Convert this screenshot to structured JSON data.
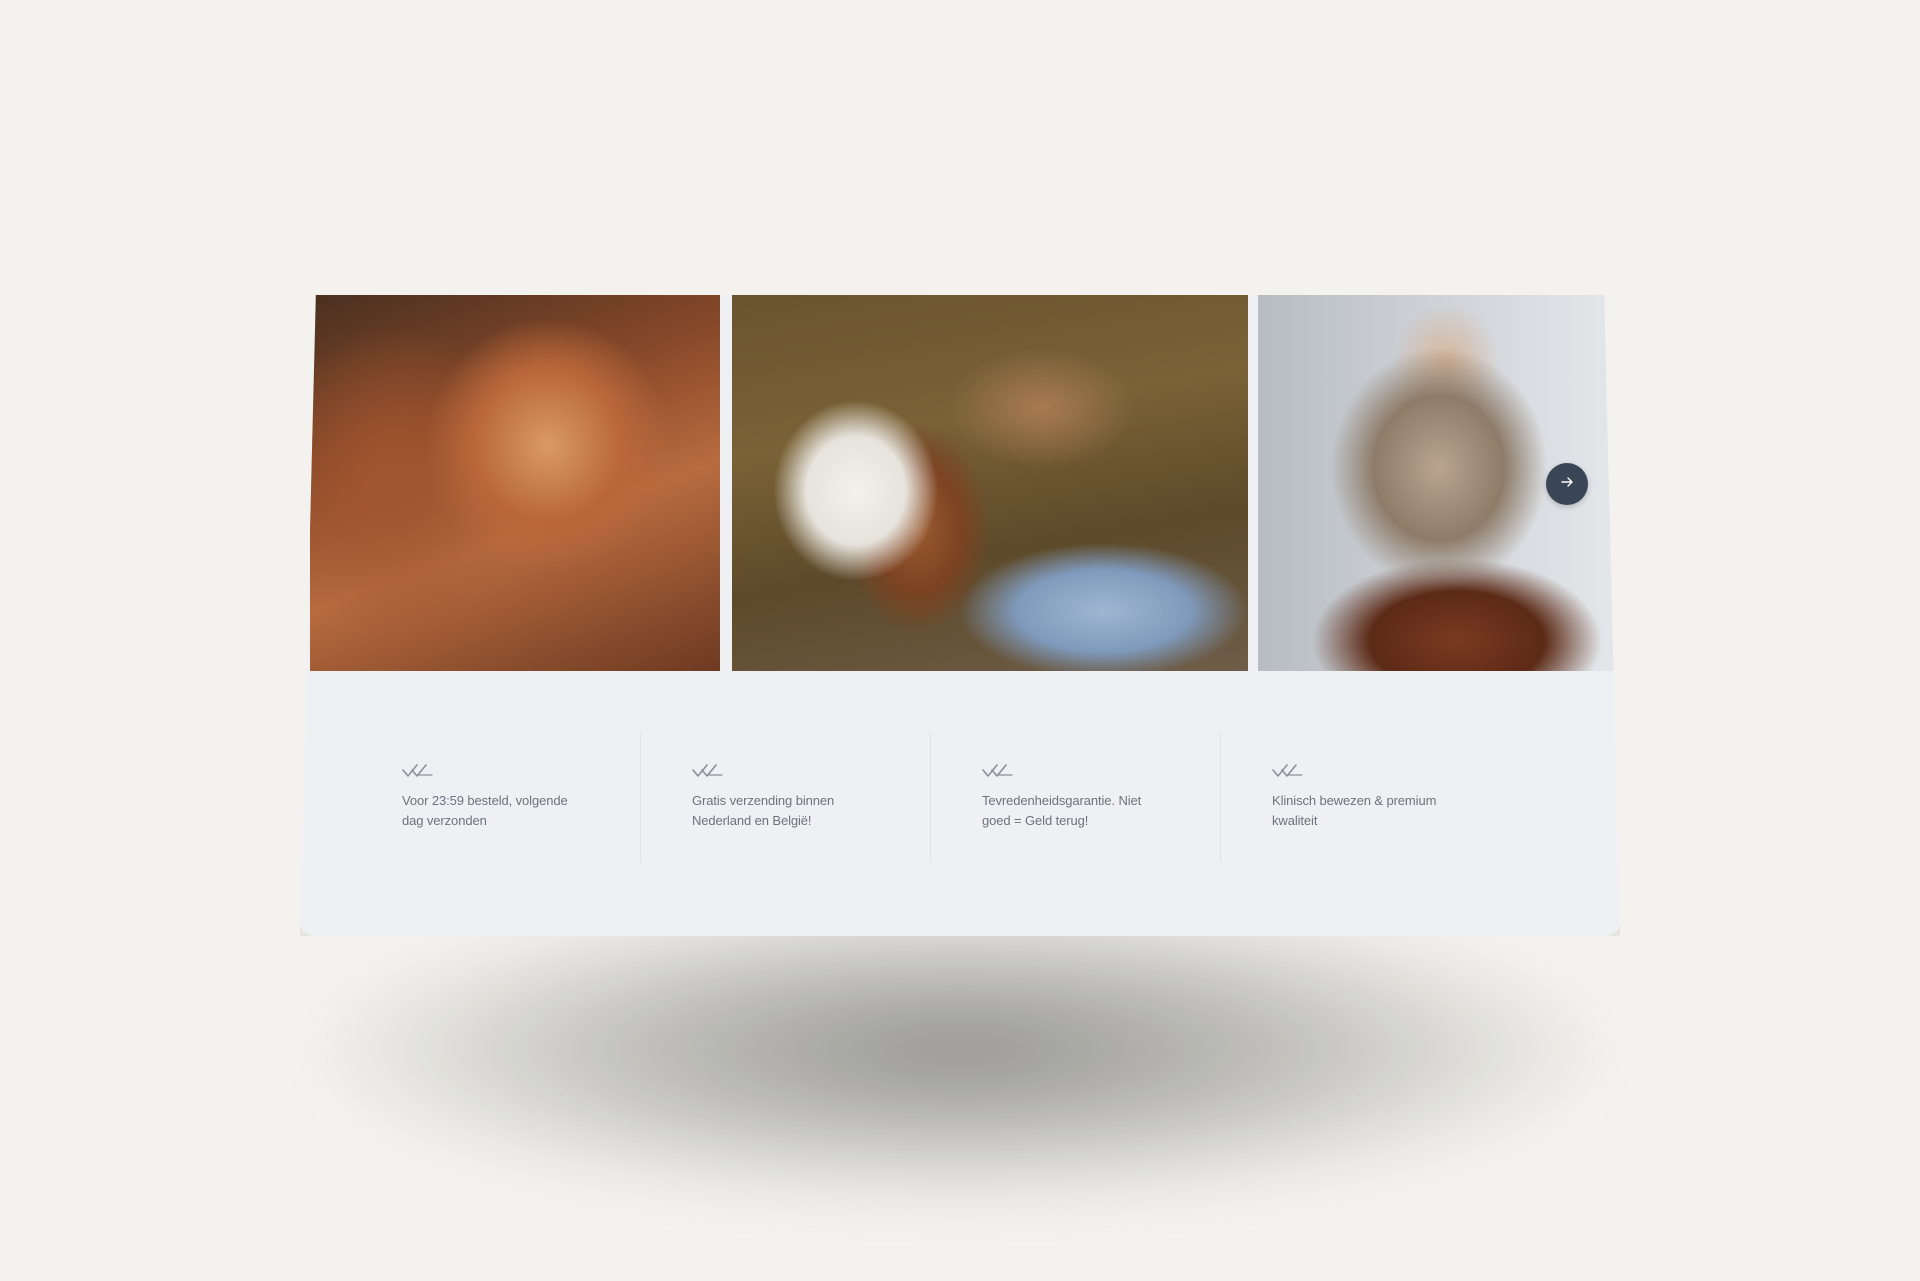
{
  "colors": {
    "background": "#f3f2ee",
    "card": "#eef0f3",
    "text": "#6d737c",
    "button": "#3a4556",
    "icon": "#8c9098"
  },
  "gallery": {
    "next_icon": "arrow-right-icon",
    "next_glyph": "→"
  },
  "features": [
    {
      "icon": "double-check-icon",
      "text": "Voor 23:59 besteld, volgende dag verzonden"
    },
    {
      "icon": "double-check-icon",
      "text": "Gratis verzending binnen Nederland en België!"
    },
    {
      "icon": "double-check-icon",
      "text": "Tevredenheidsgarantie. Niet goed = Geld terug!"
    },
    {
      "icon": "double-check-icon",
      "text": "Klinisch bewezen & premium kwaliteit"
    }
  ]
}
